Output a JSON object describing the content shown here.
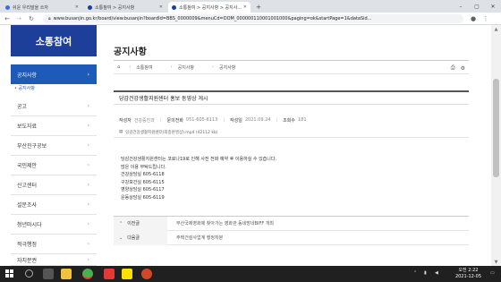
{
  "browser": {
    "tabs": [
      {
        "label": "쉬운 우리말을 쓰자",
        "favicon_color": "#3b6fd4",
        "active": false
      },
      {
        "label": "소통참여 > 공지사항",
        "favicon_color": "#1d3f9a",
        "active": false
      },
      {
        "label": "소통참여 > 공지사항 > 공지사...",
        "favicon_color": "#1d3f9a",
        "active": true
      }
    ],
    "new_tab_label": "+",
    "window_controls": {
      "minimize": "–",
      "maximize": "▢",
      "close": "✕"
    },
    "url": "www.busanjin.go.kr/board/view.busanjin?boardId=BBS_0000009&menuCd=DOM_000000110001001000&paging=ok&startPage=1&dataSid..."
  },
  "sidebar": {
    "title": "소통참여",
    "items": [
      {
        "label": "공지사항",
        "active": true
      },
      {
        "label": "공고"
      },
      {
        "label": "보도자료"
      },
      {
        "label": "부산진구공보"
      },
      {
        "label": "국민제안"
      },
      {
        "label": "신고센터"
      },
      {
        "label": "설문조사"
      },
      {
        "label": "청년마시다"
      },
      {
        "label": "적극행정"
      },
      {
        "label": "자치분권"
      }
    ],
    "sub_item": "• 공지사항"
  },
  "page": {
    "title": "공지사항",
    "breadcrumb": [
      "소통참여",
      "공지사항",
      "공지사항"
    ],
    "post": {
      "title": "당감건강생활지원센터 홍보 동영상 게시",
      "author_label": "작성자",
      "author": "건강증진과",
      "phone_label": "문의전화",
      "phone": "051-605-6113",
      "date_label": "작성일",
      "date": "2021.09.24",
      "views_label": "조회수",
      "views": "181",
      "attachment": "당감건강생활지원센터(최종본영상).mp4 (42112 kb)"
    },
    "content": [
      "당감건강생활지원센터는 코로나19로 인해 사전 전화 예약 후 이용하실 수 있습니다.",
      "많은 이용 부탁드립니다.",
      "건강상담실 605-6118",
      "구강보건실 605-6115",
      "영양상담실 605-6117",
      "운동상담실 605-6119"
    ],
    "prev_label": "이전글",
    "prev_title": "부산국제영화제 찾아가는 영화관 동네방네BIFF 개최",
    "next_label": "다음글",
    "next_title": "주택건설사업계 행정처분"
  },
  "taskbar": {
    "time": "오전 2:22",
    "date": "2021-12-05"
  }
}
